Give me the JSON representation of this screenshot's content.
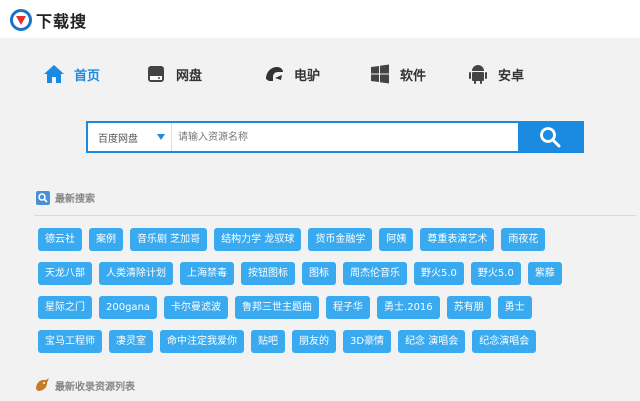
{
  "header": {
    "site_name": "下载搜"
  },
  "nav": [
    {
      "label": "首页",
      "icon": "home-icon",
      "active": true
    },
    {
      "label": "网盘",
      "icon": "disk-icon",
      "active": false
    },
    {
      "label": "电驴",
      "icon": "donkey-icon",
      "active": false
    },
    {
      "label": "软件",
      "icon": "windows-icon",
      "active": false
    },
    {
      "label": "安卓",
      "icon": "android-icon",
      "active": false
    }
  ],
  "search": {
    "category": "百度网盘",
    "placeholder": "请输入资源名称"
  },
  "recent": {
    "title": "最新搜索",
    "rows": [
      [
        "德云社",
        "案例",
        "音乐剧 芝加哥",
        "结构力学 龙驭球",
        "货币金融学",
        "阿姨",
        "尊重表演艺术",
        "雨夜花"
      ],
      [
        "天龙八部",
        "人类清除计划",
        "上海禁毒",
        "按钮图标",
        "图标",
        "周杰伦音乐",
        "野火5.0",
        "野火5.0",
        "紫藤"
      ],
      [
        "星际之门",
        "200gana",
        "卡尔曼滤波",
        "鲁邦三世主题曲",
        "程子华",
        "勇士.2016",
        "苏有朋",
        "勇士"
      ],
      [
        "宝马工程师",
        "凄灵室",
        "命中注定我爱你",
        "贴吧",
        "朋友的",
        "3D豪情",
        "纪念 演唱会",
        "纪念演唱会"
      ]
    ]
  },
  "latest": {
    "title": "最新收录资源列表"
  },
  "colors": {
    "accent": "#1a8be0",
    "tag_bg": "#3aaaf0"
  }
}
